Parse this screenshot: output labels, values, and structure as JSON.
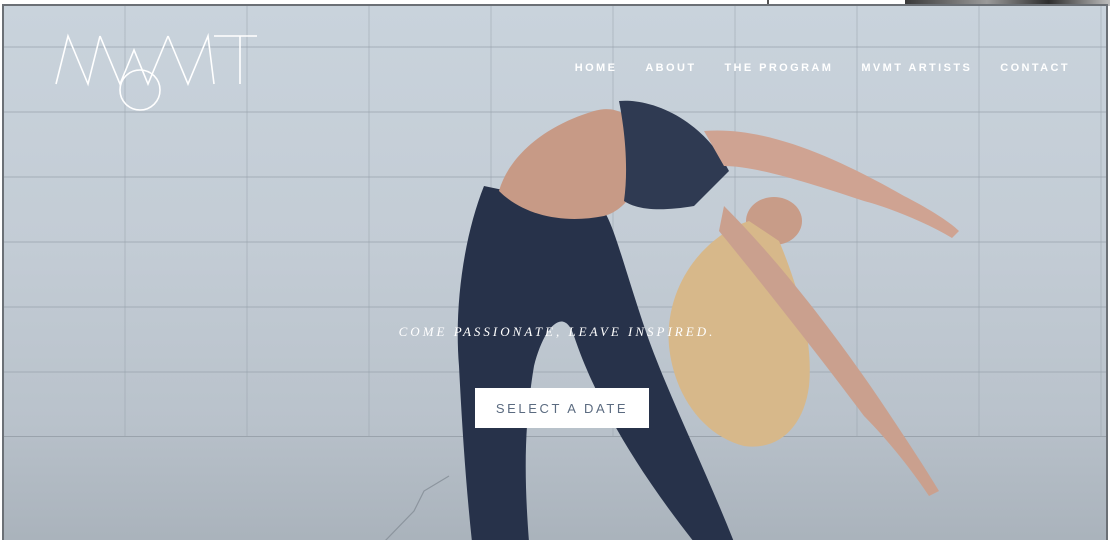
{
  "brand": {
    "logo_text": "MVMT"
  },
  "nav": {
    "items": [
      {
        "label": "HOME"
      },
      {
        "label": "ABOUT"
      },
      {
        "label": "THE PROGRAM"
      },
      {
        "label": "MVMT ARTISTS"
      },
      {
        "label": "CONTACT"
      }
    ]
  },
  "hero": {
    "tagline": "COME PASSIONATE, LEAVE INSPIRED.",
    "cta_label": "SELECT A DATE"
  },
  "colors": {
    "cta_text": "#5b6b80",
    "nav_text": "#ffffff",
    "wall": "#c6d0d9"
  }
}
